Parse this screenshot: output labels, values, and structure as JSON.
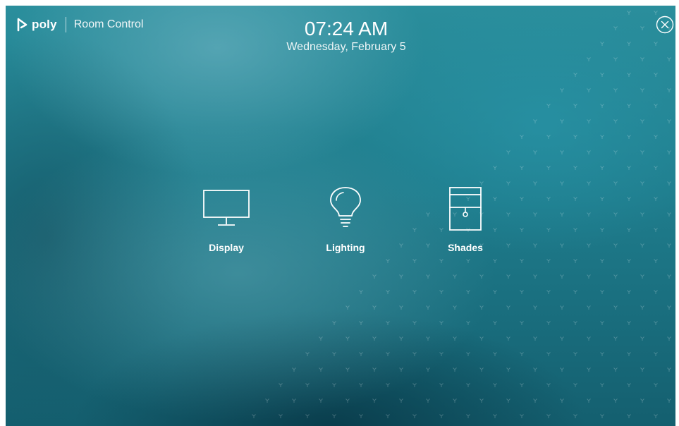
{
  "brand": {
    "logo_text": "poly",
    "app_title": "Room Control"
  },
  "clock": {
    "time": "07:24 AM",
    "date": "Wednesday, February 5"
  },
  "controls": [
    {
      "label": "Display",
      "icon": "display-icon"
    },
    {
      "label": "Lighting",
      "icon": "lightbulb-icon"
    },
    {
      "label": "Shades",
      "icon": "shades-icon"
    }
  ],
  "colors": {
    "background_top": "#2a8e9c",
    "background_bottom": "#145f6f",
    "foreground": "#ffffff"
  }
}
